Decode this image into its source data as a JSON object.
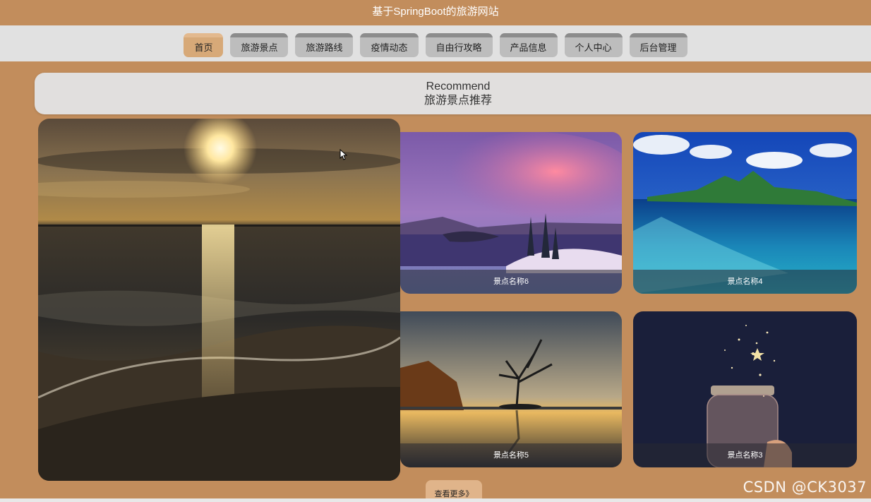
{
  "site": {
    "title": "基于SpringBoot的旅游网站"
  },
  "nav": {
    "items": [
      {
        "label": "首页",
        "active": true
      },
      {
        "label": "旅游景点"
      },
      {
        "label": "旅游路线"
      },
      {
        "label": "疫情动态"
      },
      {
        "label": "自由行攻略"
      },
      {
        "label": "产品信息"
      },
      {
        "label": "个人中心"
      },
      {
        "label": "后台管理"
      }
    ]
  },
  "section": {
    "title_en": "Recommend",
    "title_cn": "旅游景点推荐"
  },
  "cards": {
    "featured": {
      "image": "sunset-beach"
    },
    "c6": {
      "name": "景点名称6",
      "image": "crater-lake-pink-cloud"
    },
    "c4": {
      "name": "景点名称4",
      "image": "tropical-island"
    },
    "c5": {
      "name": "景点名称5",
      "image": "lone-tree-lake"
    },
    "c3": {
      "name": "景点名称3",
      "image": "star-jar"
    }
  },
  "more_button": {
    "label": "查看更多》"
  },
  "watermark": "CSDN @CK3037",
  "colors": {
    "page_bg": "#c28d5c",
    "nav_bg": "#e1e1e1",
    "active_tab": "#d7a978",
    "tab": "#bdbdbd"
  }
}
